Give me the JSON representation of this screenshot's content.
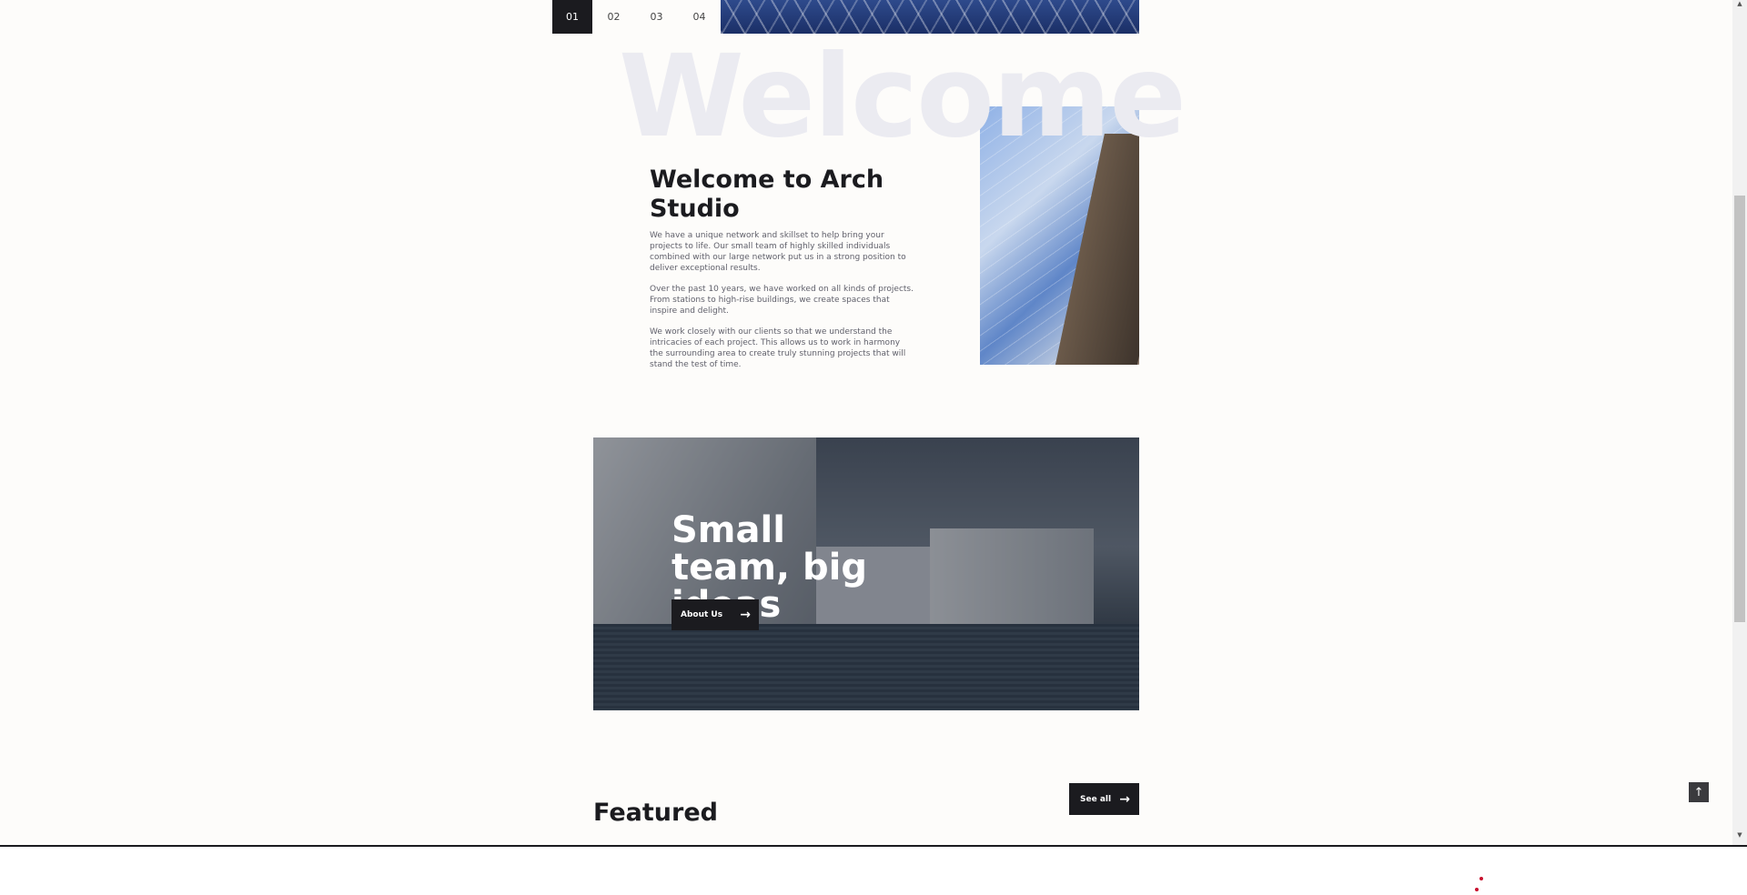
{
  "slider": {
    "tabs": [
      "01",
      "02",
      "03",
      "04"
    ],
    "active_index": 0
  },
  "welcome": {
    "bg_word": "Welcome",
    "title": "Welcome to Arch Studio",
    "paragraphs": [
      "We have a unique network and skillset to help bring your projects to life. Our small team of highly skilled individuals combined with our large network put us in a strong position to deliver exceptional results.",
      "Over the past 10 years, we have worked on all kinds of projects. From stations to high-rise buildings, we create spaces that inspire and delight.",
      "We work closely with our clients so that we understand the intricacies of each project. This allows us to work in harmony the surrounding area to create truly stunning projects that will stand the test of time."
    ]
  },
  "banner": {
    "title": "Small team, big ideas",
    "button_label": "About Us",
    "button_icon": "arrow-right-icon"
  },
  "featured": {
    "title": "Featured",
    "see_all_label": "See all",
    "see_all_icon": "arrow-right-icon"
  },
  "scroll_to_top": {
    "icon": "arrow-up-icon"
  },
  "colors": {
    "dark": "#1b1b1f",
    "bg": "#fdfcfa",
    "bg_word": "#ebebf1",
    "loader": "#c8102e"
  }
}
